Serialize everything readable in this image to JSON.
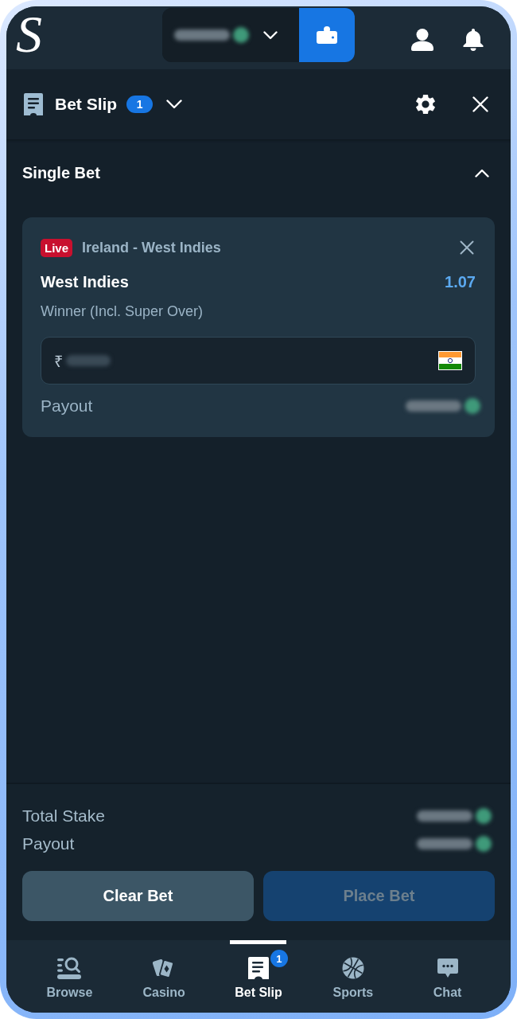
{
  "top_bar": {
    "logo": "S",
    "balance": {
      "redacted": true
    }
  },
  "bet_slip_header": {
    "title": "Bet Slip",
    "count": "1"
  },
  "section": {
    "title": "Single Bet",
    "expanded": true
  },
  "bets": [
    {
      "live_badge": "Live",
      "event": "Ireland - West Indies",
      "selection": "West Indies",
      "odds": "1.07",
      "market": "Winner (Incl. Super Over)",
      "stake": {
        "currency_symbol": "₹",
        "redacted": true
      },
      "payout": {
        "label": "Payout",
        "redacted": true
      }
    }
  ],
  "summary": [
    {
      "label": "Total Stake",
      "redacted": true
    },
    {
      "label": "Payout",
      "redacted": true
    }
  ],
  "buttons": [
    {
      "label": "Clear Bet",
      "kind": "secondary",
      "disabled": false
    },
    {
      "label": "Place Bet",
      "kind": "primary",
      "disabled": true
    }
  ],
  "nav": [
    {
      "label": "Browse",
      "kind": "browse",
      "selected": false
    },
    {
      "label": "Casino",
      "kind": "casino",
      "selected": false
    },
    {
      "label": "Bet Slip",
      "kind": "betslip",
      "selected": true,
      "badge": "1"
    },
    {
      "label": "Sports",
      "kind": "sports",
      "selected": false
    },
    {
      "label": "Chat",
      "kind": "chat",
      "selected": false
    }
  ]
}
